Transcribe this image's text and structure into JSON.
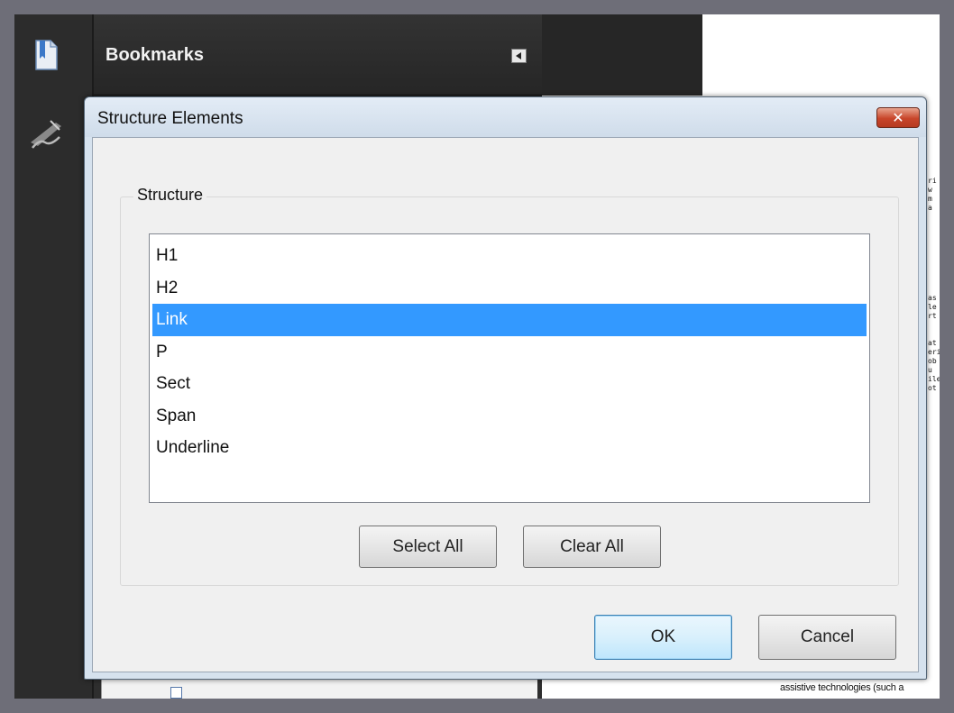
{
  "nav_panel": {
    "title": "Bookmarks",
    "icons": [
      "bookmarks-icon",
      "signature-icon",
      "collapse-arrow-icon"
    ]
  },
  "dialog": {
    "title": "Structure Elements",
    "group_label": "Structure",
    "items": [
      {
        "label": "H1",
        "selected": false
      },
      {
        "label": "H2",
        "selected": false
      },
      {
        "label": "Link",
        "selected": true
      },
      {
        "label": "P",
        "selected": false
      },
      {
        "label": "Sect",
        "selected": false
      },
      {
        "label": "Span",
        "selected": false
      },
      {
        "label": "Underline",
        "selected": false
      }
    ],
    "select_all_label": "Select All",
    "clear_all_label": "Clear All",
    "ok_label": "OK",
    "cancel_label": "Cancel",
    "close_label": "✕"
  },
  "document": {
    "bottom_line": "assistive technologies (such a"
  },
  "colors": {
    "selection": "#3399ff",
    "close_button": "#c8452a",
    "panel_dark": "#2e2e2e"
  }
}
